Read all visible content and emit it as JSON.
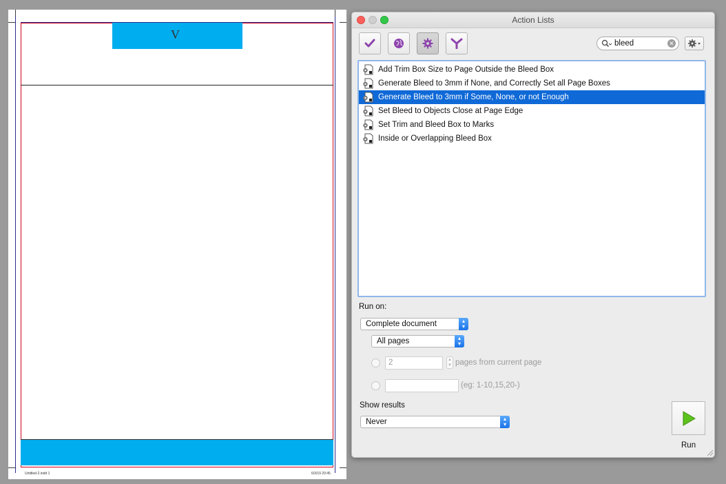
{
  "document": {
    "top_bar_text": "V",
    "slug_left": "Untitled-2.indd   1",
    "slug_right": "6/3/19   20:45"
  },
  "panel": {
    "title": "Action Lists",
    "toolbar": {
      "buttons": [
        {
          "name": "check-icon",
          "color": "#8e44ad"
        },
        {
          "name": "globe-icon",
          "color": "#8e44ad"
        },
        {
          "name": "gear-icon",
          "color": "#8e44ad",
          "active": true
        },
        {
          "name": "branch-icon",
          "color": "#8e44ad"
        }
      ]
    },
    "search": {
      "value": "bleed"
    },
    "actions": [
      {
        "label": "Add Trim Box Size to Page Outside the Bleed Box",
        "selected": false
      },
      {
        "label": "Generate Bleed to 3mm if None, and Correctly Set all Page Boxes",
        "selected": false
      },
      {
        "label": "Generate Bleed to 3mm if Some, None, or not Enough",
        "selected": true
      },
      {
        "label": "Set Bleed to Objects Close at Page Edge",
        "selected": false
      },
      {
        "label": "Set Trim and Bleed Box to Marks",
        "selected": false
      },
      {
        "label": "Inside or Overlapping Bleed Box",
        "selected": false
      }
    ],
    "run_on": {
      "label": "Run on:",
      "scope": "Complete document",
      "pages": "All pages",
      "page_count": "2",
      "page_count_suffix": "pages from current page",
      "range_value": "",
      "range_hint": "(eg: 1-10,15,20-)"
    },
    "show_results": {
      "label": "Show results",
      "value": "Never"
    },
    "run_label": "Run",
    "colors": {
      "selection": "#0f69d7",
      "accent_blue": "#00adef",
      "bleed_red": "#d0021b",
      "run_green": "#5cc21e"
    }
  }
}
